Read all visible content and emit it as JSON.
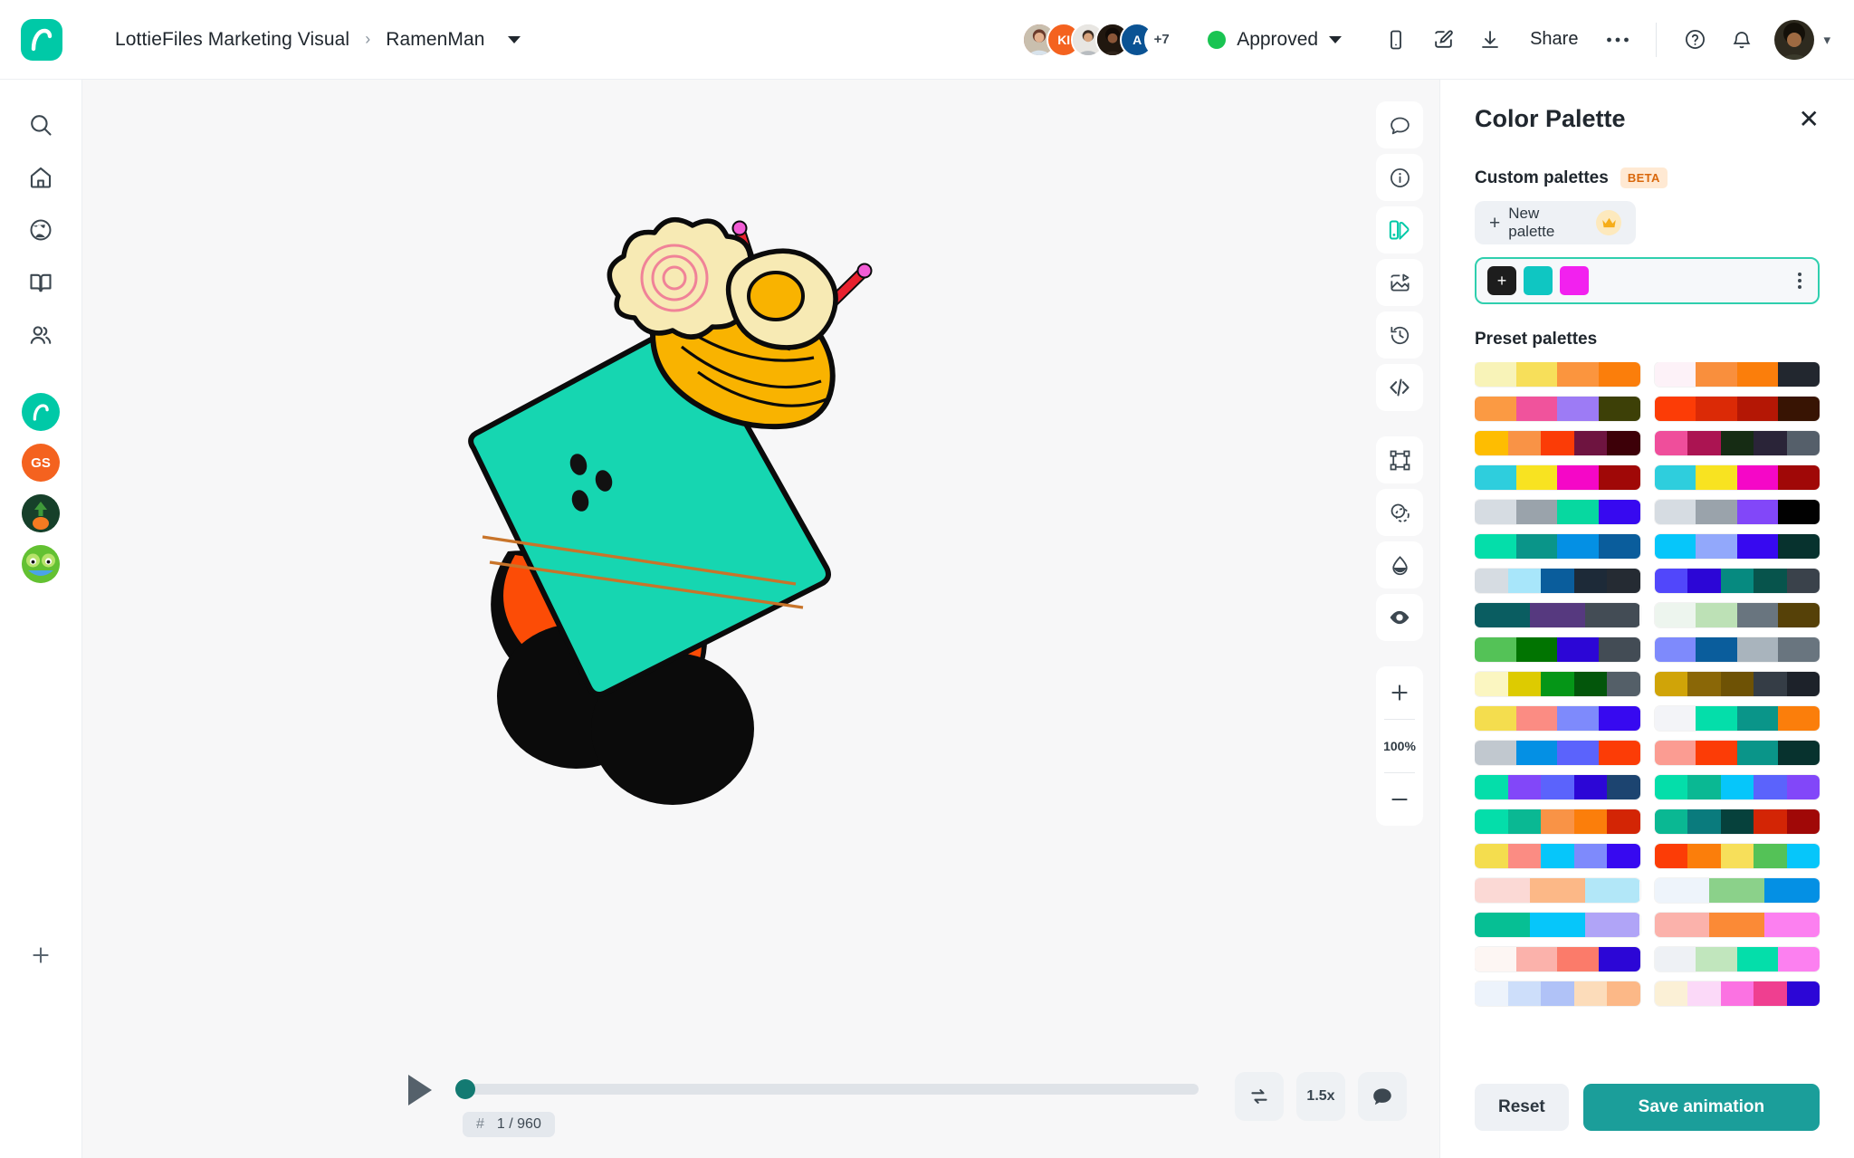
{
  "app": {
    "logo_icon": "lottiefiles-logo-icon",
    "brand_color": "#00c9a7"
  },
  "header": {
    "breadcrumb": {
      "parent": "LottieFiles Marketing Visual",
      "separator": "›",
      "current": "RamenMan",
      "caret_icon": "chevron-down-icon"
    },
    "collaborators": {
      "visible": [
        {
          "initials": "",
          "type": "photo",
          "color": "#b45f4d"
        },
        {
          "initials": "KI",
          "type": "initials",
          "color": "#f4621f"
        },
        {
          "initials": "",
          "type": "photo",
          "color": "#d8d4cf"
        },
        {
          "initials": "",
          "type": "photo",
          "color": "#2b2018"
        },
        {
          "initials": "A",
          "type": "initials",
          "color": "#0b5394"
        }
      ],
      "overflow_label": "+7"
    },
    "status": {
      "label": "Approved",
      "dot_color": "#19c452",
      "caret_icon": "chevron-down-icon"
    },
    "actions": [
      {
        "name": "preview-mobile-icon",
        "label": "Mobile preview"
      },
      {
        "name": "edit-icon",
        "label": "Edit"
      },
      {
        "name": "download-icon",
        "label": "Download"
      }
    ],
    "share_label": "Share",
    "more_icon": "ellipsis-icon",
    "help_icon": "help-circle-icon",
    "notifications_icon": "bell-icon",
    "user_avatar_icon": "user-avatar",
    "user_caret_icon": "chevron-down-icon"
  },
  "sidebar": {
    "items": [
      {
        "name": "sidebar-item-search",
        "icon": "search-icon",
        "label": "Search"
      },
      {
        "name": "sidebar-item-home",
        "icon": "home-icon",
        "label": "Home"
      },
      {
        "name": "sidebar-item-discover",
        "icon": "globe-icon",
        "label": "Discover"
      },
      {
        "name": "sidebar-item-learn",
        "icon": "book-icon",
        "label": "Learn"
      },
      {
        "name": "sidebar-item-community",
        "icon": "people-icon",
        "label": "Community"
      }
    ],
    "workspaces": [
      {
        "name": "workspace-lottiefiles",
        "label": "",
        "color": "#00c9a7",
        "icon": "lottiefiles-logo-icon"
      },
      {
        "name": "workspace-gs",
        "label": "GS",
        "color": "#f4621f",
        "icon": "initials-avatar"
      },
      {
        "name": "workspace-green",
        "label": "",
        "color": "#16402a",
        "icon": "avocado-avatar"
      },
      {
        "name": "workspace-frog",
        "label": "",
        "color": "#7ac943",
        "icon": "frog-avatar"
      }
    ],
    "add_label": "+",
    "add_icon": "plus-icon"
  },
  "canvas_tools": {
    "top": [
      {
        "name": "tool-comments",
        "icon": "comment-icon",
        "active": false
      },
      {
        "name": "tool-info",
        "icon": "info-circle-icon",
        "active": false
      },
      {
        "name": "tool-color-palette",
        "icon": "color-palette-icon",
        "active": true
      },
      {
        "name": "tool-export-media",
        "icon": "image-play-icon",
        "active": false
      },
      {
        "name": "tool-version-history",
        "icon": "history-clock-icon",
        "active": false
      },
      {
        "name": "tool-code",
        "icon": "code-brackets-icon",
        "active": false
      }
    ],
    "bottom": [
      {
        "name": "tool-bounding-box",
        "icon": "bounding-box-icon"
      },
      {
        "name": "tool-mask",
        "icon": "mask-circles-icon"
      },
      {
        "name": "tool-contrast",
        "icon": "droplet-contrast-icon"
      },
      {
        "name": "tool-visibility",
        "icon": "eye-icon"
      }
    ],
    "zoom": {
      "in_icon": "plus-icon",
      "level": "100%",
      "out_icon": "minus-icon"
    }
  },
  "playback": {
    "play_icon": "play-icon",
    "progress_percent": 0,
    "frame_hash": "#",
    "frame_label": "1 / 960",
    "loop_icon": "loop-icon",
    "speed_label": "1.5x",
    "comment_icon": "comment-filled-icon"
  },
  "panel": {
    "title": "Color Palette",
    "close_icon": "close-icon",
    "custom": {
      "section_title": "Custom palettes",
      "badge": "BETA",
      "new_palette_label": "New palette",
      "new_palette_plus": "+",
      "crown_icon": "crown-icon",
      "add_swatch_icon": "plus-icon",
      "kebab_icon": "kebab-menu-icon",
      "swatches": [
        "#0fc6c2",
        "#f221ef"
      ]
    },
    "presets": {
      "section_title": "Preset palettes",
      "palettes": [
        [
          "#f8f3b8",
          "#f7df5a",
          "#fb953e",
          "#fb7e0b"
        ],
        [
          "#fdf2f8",
          "#f98f3d",
          "#fb7e0b",
          "#22272f"
        ],
        [
          "#fb9a43",
          "#f0539c",
          "#9d7bf5",
          "#3d4007"
        ],
        [
          "#fc3c06",
          "#db2a06",
          "#b41705",
          "#381403"
        ],
        [
          "#febd01",
          "#f99346",
          "#fb3c06",
          "#6e1440",
          "#3d0008"
        ],
        [
          "#ef4e9b",
          "#ab1452",
          "#162c14",
          "#2a2438",
          "#555f6a"
        ],
        [
          "#2ecedd",
          "#f8e321",
          "#f507c7",
          "#a00807"
        ],
        [
          "#2ecedd",
          "#f8e321",
          "#f507c7",
          "#a00807"
        ],
        [
          "#d6dce2",
          "#9aa3ab",
          "#07d8a0",
          "#3709f0"
        ],
        [
          "#d6dce2",
          "#9aa3ab",
          "#8247f9",
          "#010101"
        ],
        [
          "#04deaa",
          "#0a9589",
          "#0490e4",
          "#0a5d9c"
        ],
        [
          "#06c6fa",
          "#92a8fb",
          "#3709f0",
          "#07322e"
        ],
        [
          "#d6dce2",
          "#a8e6fa",
          "#0a5d9c",
          "#1d2a38",
          "#252b33"
        ],
        [
          "#5147fb",
          "#2c06d6",
          "#068a80",
          "#07544c",
          "#3a424b"
        ],
        [
          "#0a5d61",
          "#56397f",
          "#434c55"
        ],
        [
          "#edf5ee",
          "#bde1b6",
          "#69757f",
          "#564108"
        ],
        [
          "#54c257",
          "#017401",
          "#2c06d6",
          "#434c55"
        ],
        [
          "#7e8afc",
          "#0a5d9c",
          "#a9b4bd",
          "#69757f"
        ],
        [
          "#fbf6c1",
          "#ddcb01",
          "#059617",
          "#03560b",
          "#545f68"
        ],
        [
          "#d0a408",
          "#8a6707",
          "#6e5205",
          "#353d46",
          "#1d222a"
        ],
        [
          "#f4dd4e",
          "#fb8c83",
          "#7e8afc",
          "#3709f0"
        ],
        [
          "#f3f4f8",
          "#04deaa",
          "#0a9589",
          "#fb7e0b"
        ],
        [
          "#c1c8cf",
          "#0490e4",
          "#5b63fc",
          "#fc3c06"
        ],
        [
          "#fb9c92",
          "#fc3c06",
          "#0a9589",
          "#07322e"
        ],
        [
          "#04deaa",
          "#8247f9",
          "#5b63fc",
          "#2c06d6",
          "#1c4470"
        ],
        [
          "#04deaa",
          "#0ab893",
          "#06c6fa",
          "#5b63fc",
          "#8247f9"
        ],
        [
          "#04deaa",
          "#0ab893",
          "#f99346",
          "#fb7e0b",
          "#d32505"
        ],
        [
          "#0ab893",
          "#0a7b7d",
          "#06413c",
          "#d32505",
          "#a00807"
        ],
        [
          "#f4dd4e",
          "#fb8c83",
          "#06c6fa",
          "#7e8afc",
          "#3709f0"
        ],
        [
          "#fc3c06",
          "#fb7e0b",
          "#f7df5a",
          "#54c257",
          "#06c6fa"
        ],
        [
          "#fbd9d5",
          "#fcb887",
          "#b2e7f8"
        ],
        [
          "#eef4fb",
          "#8bd18a",
          "#0490e4"
        ],
        [
          "#06bf94",
          "#06c6fa",
          "#b0a4f7"
        ],
        [
          "#fbb2ab",
          "#fb8a36",
          "#fc80f0"
        ],
        [
          "#fdf6f3",
          "#fbb2ab",
          "#fb7b6a",
          "#2c06d6"
        ],
        [
          "#eef1f5",
          "#c1e6bd",
          "#04deaa",
          "#fc80f0"
        ],
        [
          "#edf3fb",
          "#cddefa",
          "#b0c2f7",
          "#fcdcba",
          "#fcb887"
        ],
        [
          "#fbf0d6",
          "#fbd9f8",
          "#fb72e2",
          "#ef3f90",
          "#2c06d6"
        ]
      ]
    },
    "footer": {
      "reset_label": "Reset",
      "save_label": "Save animation",
      "save_color": "#1b9e9a"
    }
  },
  "artwork": {
    "name": "ramen-cup-character",
    "colors": {
      "cup": "#16d6b1",
      "noodles": "#f9b300",
      "egg_white": "#f7eab4",
      "egg_yolk": "#f9b300",
      "naruto": "#f7eab4",
      "naruto_swirl": "#f08398",
      "chopstick": "#e8212e",
      "chopstick_tip": "#f25cd5",
      "shoe": "#fc4c06",
      "leg": "#0b0b0b",
      "stripe": "#c8742a",
      "outline": "#0b0b0b"
    }
  }
}
